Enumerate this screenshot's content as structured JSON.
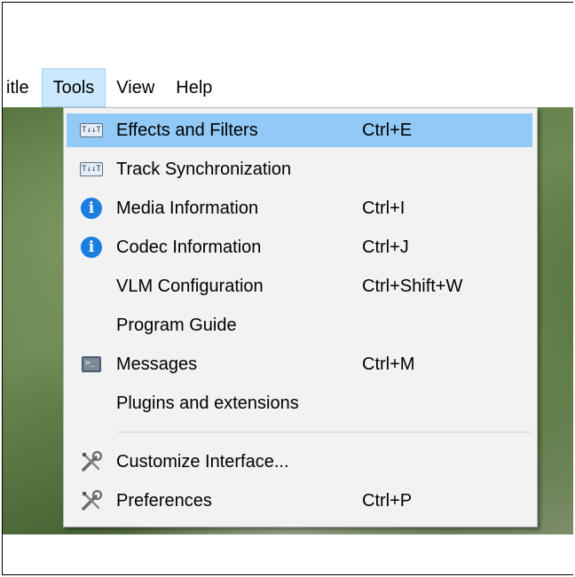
{
  "menubar": {
    "items": [
      "itle",
      "Tools",
      "View",
      "Help"
    ],
    "active_index": 1
  },
  "menu": {
    "items": [
      {
        "label": "Effects and Filters",
        "shortcut": "Ctrl+E",
        "icon": "equalizer-icon",
        "highlighted": true
      },
      {
        "label": "Track Synchronization",
        "shortcut": "",
        "icon": "equalizer-icon"
      },
      {
        "label": "Media Information",
        "shortcut": "Ctrl+I",
        "icon": "info-icon"
      },
      {
        "label": "Codec Information",
        "shortcut": "Ctrl+J",
        "icon": "info-icon"
      },
      {
        "label": "VLM Configuration",
        "shortcut": "Ctrl+Shift+W",
        "icon": ""
      },
      {
        "label": "Program Guide",
        "shortcut": "",
        "icon": ""
      },
      {
        "label": "Messages",
        "shortcut": "Ctrl+M",
        "icon": "terminal-icon"
      },
      {
        "label": "Plugins and extensions",
        "shortcut": "",
        "icon": ""
      },
      {
        "label": "Customize Interface...",
        "shortcut": "",
        "icon": "tools-icon"
      },
      {
        "label": "Preferences",
        "shortcut": "Ctrl+P",
        "icon": "tools-icon"
      }
    ]
  },
  "icons": {
    "equalizer_glyph": "T↓↓T",
    "info_glyph": "i",
    "terminal_glyph": ">_"
  },
  "colors": {
    "highlight": "#91c9f7",
    "menubar_active": "#cce8ff",
    "info_blue": "#1a7ee0"
  }
}
